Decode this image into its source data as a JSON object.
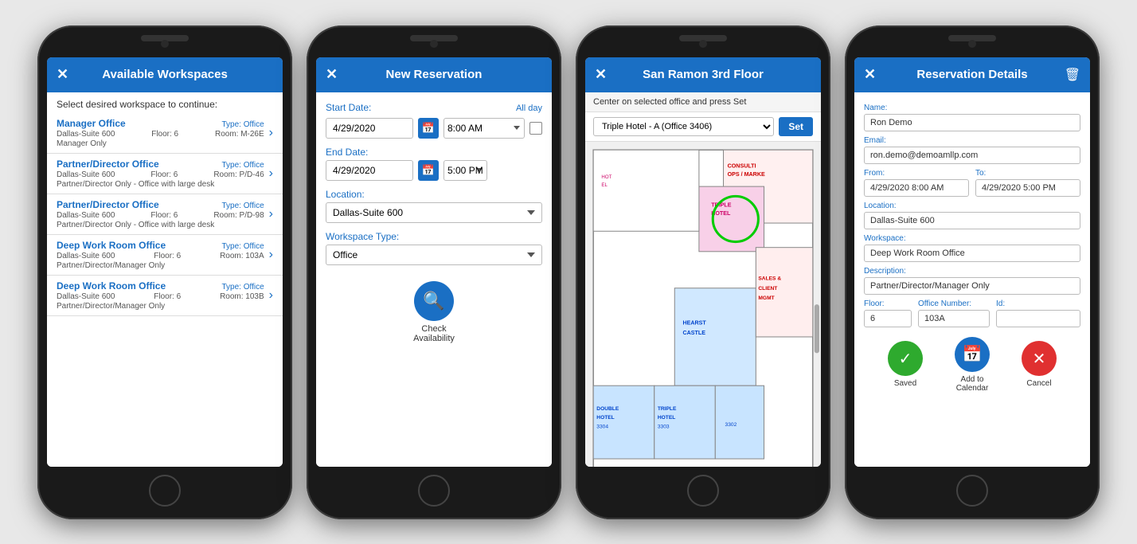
{
  "phone1": {
    "header": "Available Workspaces",
    "subtitle": "Select desired workspace to continue:",
    "items": [
      {
        "name": "Manager Office",
        "type": "Type: Office",
        "location": "Dallas-Suite 600",
        "floor": "Floor: 6",
        "room": "Room: M-26E",
        "note": "Manager Only"
      },
      {
        "name": "Partner/Director Office",
        "type": "Type: Office",
        "location": "Dallas-Suite 600",
        "floor": "Floor: 6",
        "room": "Room: P/D-46",
        "note": "Partner/Director Only - Office with large desk"
      },
      {
        "name": "Partner/Director Office",
        "type": "Type: Office",
        "location": "Dallas-Suite 600",
        "floor": "Floor: 6",
        "room": "Room: P/D-98",
        "note": "Partner/Director Only - Office with large desk"
      },
      {
        "name": "Deep Work Room Office",
        "type": "Type: Office",
        "location": "Dallas-Suite 600",
        "floor": "Floor: 6",
        "room": "Room: 103A",
        "note": "Partner/Director/Manager Only"
      },
      {
        "name": "Deep Work Room Office",
        "type": "Type: Office",
        "location": "Dallas-Suite 600",
        "floor": "Floor: 6",
        "room": "Room: 103B",
        "note": "Partner/Director/Manager Only"
      }
    ]
  },
  "phone2": {
    "header": "New Reservation",
    "start_date_label": "Start Date:",
    "start_date": "4/29/2020",
    "start_time": "8:00 AM",
    "all_day": "All day",
    "end_date_label": "End Date:",
    "end_date": "4/29/2020",
    "end_time": "5:00 PM",
    "location_label": "Location:",
    "location": "Dallas-Suite 600",
    "workspace_type_label": "Workspace Type:",
    "workspace_type": "Office",
    "check_availability": "Check\nAvailability"
  },
  "phone3": {
    "header": "San Ramon 3rd Floor",
    "hint": "Center on selected office and press Set",
    "dropdown_value": "Triple Hotel - A (Office 3406)",
    "set_btn": "Set",
    "map_rooms": [
      {
        "label": "TRIPLE\nHOTEL",
        "color": "#e8a0c0",
        "highlight": true
      },
      {
        "label": "CONSULTI\nOPS / MARKE",
        "color": "#ffcccc"
      },
      {
        "label": "HEARST\nCASTLE",
        "color": "#c0e0ff"
      },
      {
        "label": "SALES &\nCLIENT\nMGMT",
        "color": "#ffcccc"
      },
      {
        "label": "DOUBLE\nHOTEL\n3304",
        "color": "#c0e0ff"
      },
      {
        "label": "TRIPLE\nHOTEL\n3303",
        "color": "#c0e0ff"
      },
      {
        "label": "3302",
        "color": "#c0e0ff"
      }
    ]
  },
  "phone4": {
    "header": "Reservation Details",
    "name_label": "Name:",
    "name_value": "Ron Demo",
    "email_label": "Email:",
    "email_value": "ron.demo@demoamllp.com",
    "from_label": "From:",
    "from_value": "4/29/2020 8:00 AM",
    "to_label": "To:",
    "to_value": "4/29/2020 5:00 PM",
    "location_label": "Location:",
    "location_value": "Dallas-Suite 600",
    "workspace_label": "Workspace:",
    "workspace_value": "Deep Work Room Office",
    "description_label": "Description:",
    "description_value": "Partner/Director/Manager Only",
    "floor_label": "Floor:",
    "floor_value": "6",
    "office_num_label": "Office Number:",
    "office_num_value": "103A",
    "id_label": "Id:",
    "id_value": "",
    "saved_label": "Saved",
    "add_calendar_label": "Add to\nCalendar",
    "cancel_label": "Cancel"
  }
}
